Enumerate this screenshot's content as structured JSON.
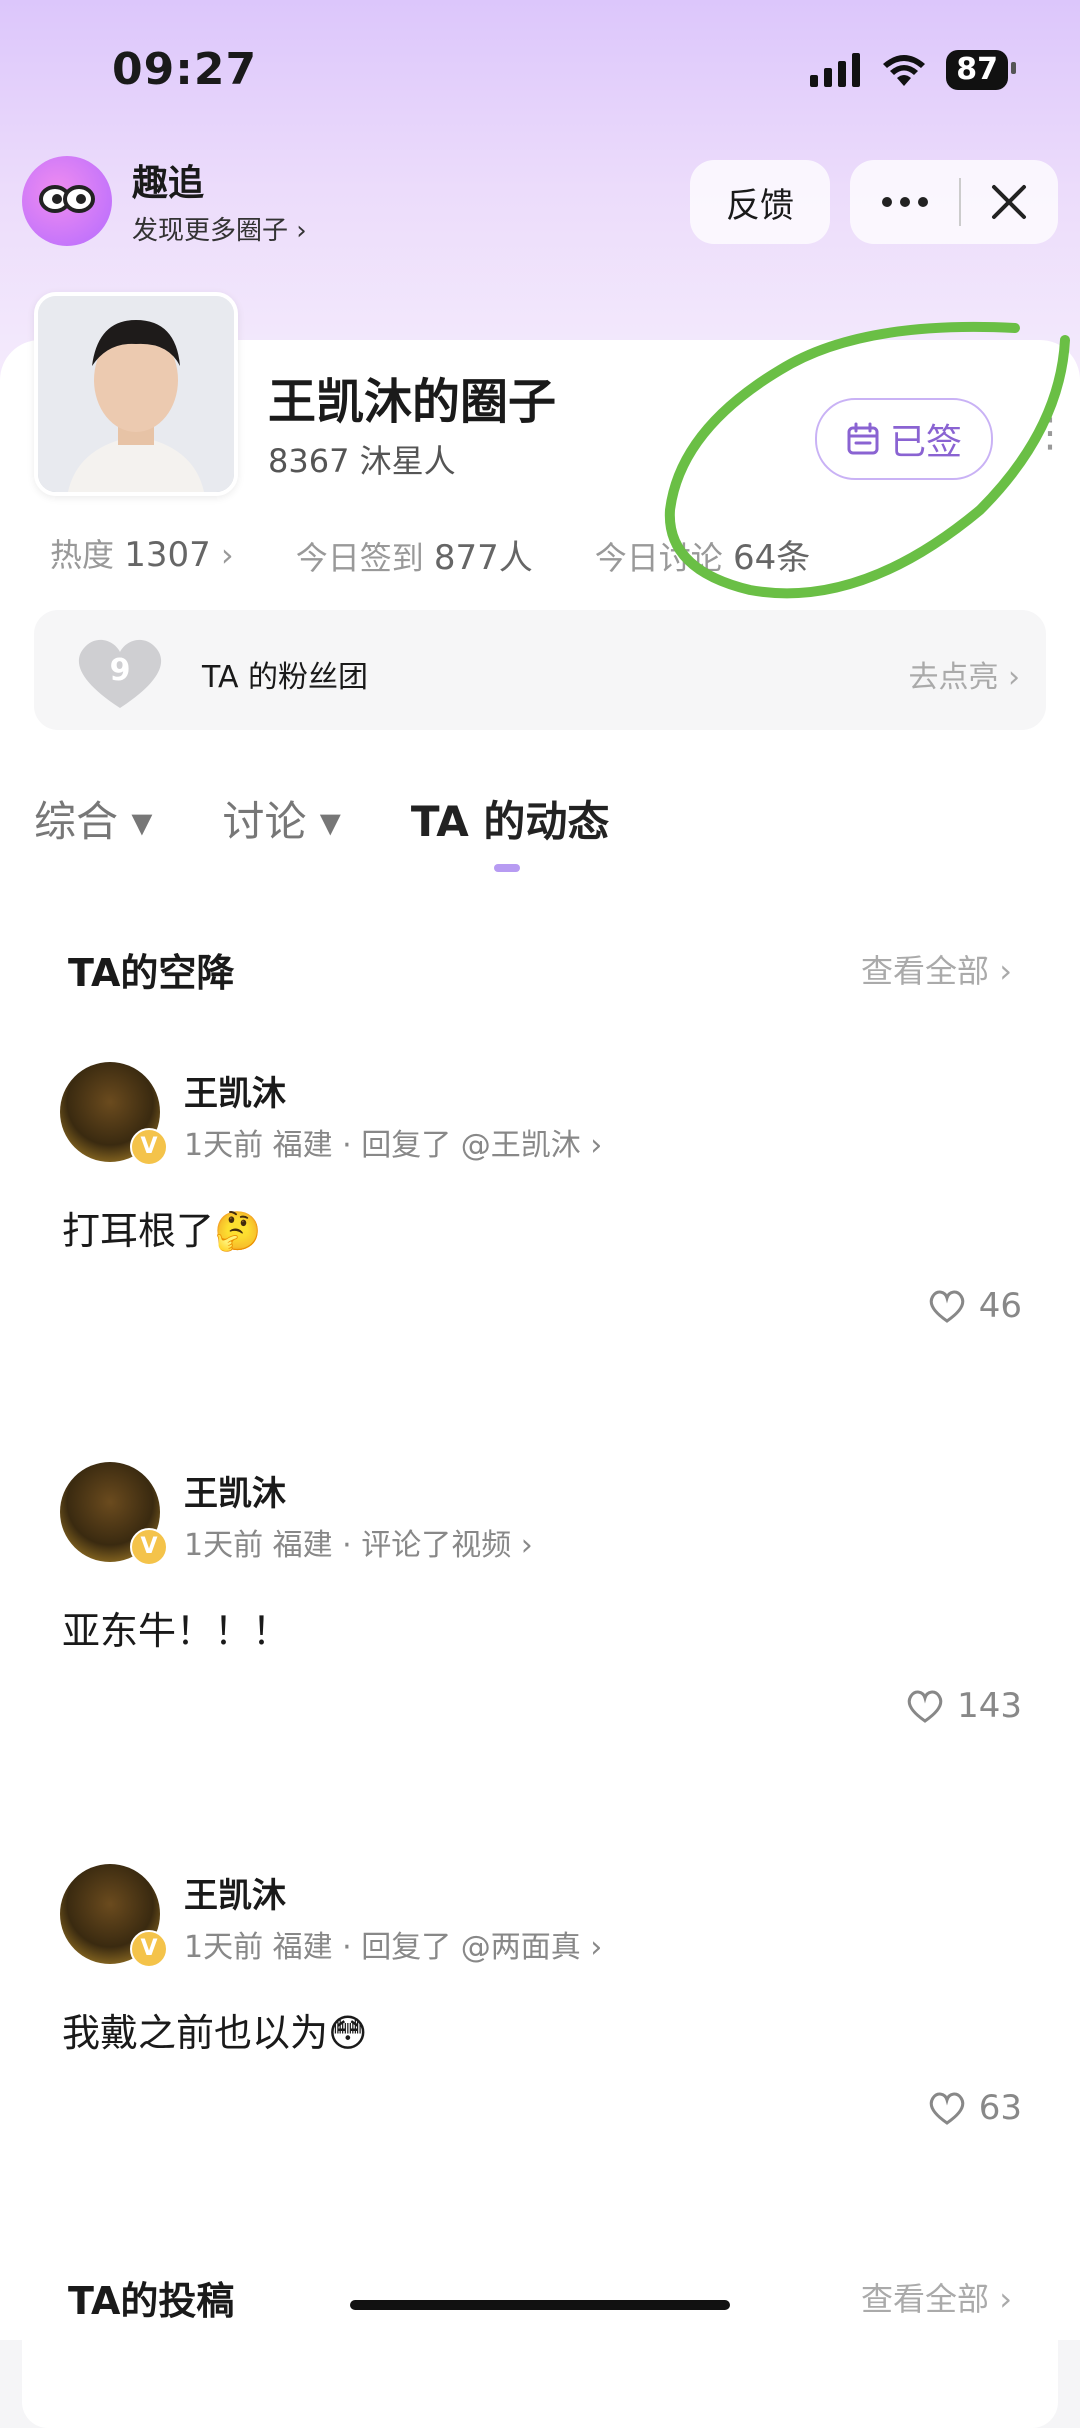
{
  "status_bar": {
    "time": "09:27",
    "battery": "87"
  },
  "mini_app": {
    "title": "趣追",
    "subtitle": "发现更多圈子 ›",
    "feedback_label": "反馈",
    "more_icon": "more-dots-icon",
    "close_icon": "close-icon"
  },
  "circle": {
    "name": "王凯沐的圈子",
    "member_count": "8367 沐星人",
    "signed_label": "已签",
    "stats": [
      {
        "label": "热度",
        "value": "1307",
        "suffix": "›"
      },
      {
        "label": "今日签到",
        "value": "877人",
        "suffix": ""
      },
      {
        "label": "今日讨论",
        "value": "64条",
        "suffix": ""
      }
    ]
  },
  "fan_club": {
    "level": "9",
    "label": "TA 的粉丝团",
    "action": "去点亮 ›"
  },
  "tabs": [
    {
      "label": "综合 ▾"
    },
    {
      "label": "讨论 ▾"
    },
    {
      "label": "TA 的动态"
    }
  ],
  "section_airdrop": {
    "title": "TA的空降",
    "view_all": "查看全部 ›",
    "posts": [
      {
        "author": "王凯沐",
        "meta": "1天前 福建 · 回复了 @王凯沐 ›",
        "text": "打耳根了🤔",
        "likes": "46"
      },
      {
        "author": "王凯沐",
        "meta": "1天前 福建 · 评论了视频 ›",
        "text": "亚东牛！！！",
        "likes": "143"
      },
      {
        "author": "王凯沐",
        "meta": "1天前 福建 · 回复了 @两面真 ›",
        "text": "我戴之前也以为😳",
        "likes": "63"
      }
    ]
  },
  "section_submissions": {
    "title": "TA的投稿",
    "view_all": "查看全部 ›"
  },
  "colors": {
    "accent": "#8a63d2",
    "annotation_green": "#6abf45"
  }
}
